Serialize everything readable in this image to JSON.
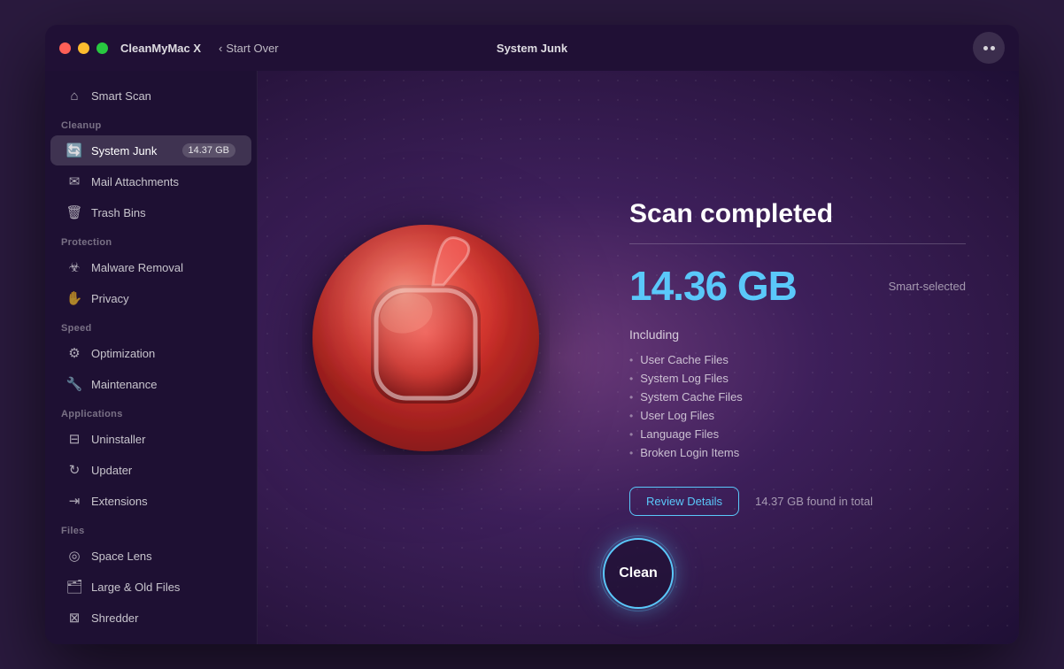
{
  "window": {
    "app_name": "CleanMyMac X",
    "title": "System Junk",
    "start_over_label": "Start Over"
  },
  "sidebar": {
    "smart_scan": "Smart Scan",
    "cleanup_label": "Cleanup",
    "system_junk": "System Junk",
    "system_junk_badge": "14.37 GB",
    "mail_attachments": "Mail Attachments",
    "trash_bins": "Trash Bins",
    "protection_label": "Protection",
    "malware_removal": "Malware Removal",
    "privacy": "Privacy",
    "speed_label": "Speed",
    "optimization": "Optimization",
    "maintenance": "Maintenance",
    "applications_label": "Applications",
    "uninstaller": "Uninstaller",
    "updater": "Updater",
    "extensions": "Extensions",
    "files_label": "Files",
    "space_lens": "Space Lens",
    "large_old_files": "Large & Old Files",
    "shredder": "Shredder"
  },
  "main": {
    "scan_completed": "Scan completed",
    "size_value": "14.36 GB",
    "smart_selected": "Smart-selected",
    "including_label": "Including",
    "file_items": [
      "User Cache Files",
      "System Log Files",
      "System Cache Files",
      "User Log Files",
      "Language Files",
      "Broken Login Items"
    ],
    "review_button": "Review Details",
    "found_text": "14.37 GB found in total",
    "clean_button": "Clean"
  },
  "colors": {
    "accent_cyan": "#5ac8fa",
    "sidebar_bg": "rgba(20,10,40,0.6)",
    "main_bg_start": "#6b3a7a",
    "main_bg_end": "#1e0f35"
  }
}
